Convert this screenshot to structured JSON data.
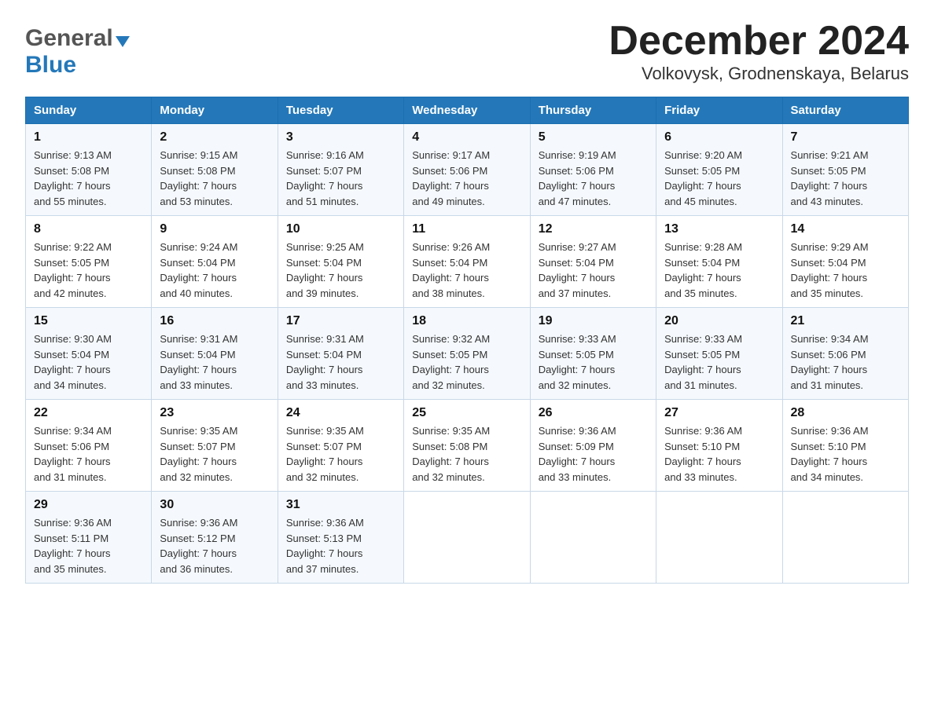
{
  "logo": {
    "line1": "General",
    "line2": "Blue"
  },
  "title": "December 2024",
  "subtitle": "Volkovysk, Grodnenskaya, Belarus",
  "days_of_week": [
    "Sunday",
    "Monday",
    "Tuesday",
    "Wednesday",
    "Thursday",
    "Friday",
    "Saturday"
  ],
  "weeks": [
    [
      {
        "day": "1",
        "sunrise": "9:13 AM",
        "sunset": "5:08 PM",
        "daylight": "7 hours and 55 minutes."
      },
      {
        "day": "2",
        "sunrise": "9:15 AM",
        "sunset": "5:08 PM",
        "daylight": "7 hours and 53 minutes."
      },
      {
        "day": "3",
        "sunrise": "9:16 AM",
        "sunset": "5:07 PM",
        "daylight": "7 hours and 51 minutes."
      },
      {
        "day": "4",
        "sunrise": "9:17 AM",
        "sunset": "5:06 PM",
        "daylight": "7 hours and 49 minutes."
      },
      {
        "day": "5",
        "sunrise": "9:19 AM",
        "sunset": "5:06 PM",
        "daylight": "7 hours and 47 minutes."
      },
      {
        "day": "6",
        "sunrise": "9:20 AM",
        "sunset": "5:05 PM",
        "daylight": "7 hours and 45 minutes."
      },
      {
        "day": "7",
        "sunrise": "9:21 AM",
        "sunset": "5:05 PM",
        "daylight": "7 hours and 43 minutes."
      }
    ],
    [
      {
        "day": "8",
        "sunrise": "9:22 AM",
        "sunset": "5:05 PM",
        "daylight": "7 hours and 42 minutes."
      },
      {
        "day": "9",
        "sunrise": "9:24 AM",
        "sunset": "5:04 PM",
        "daylight": "7 hours and 40 minutes."
      },
      {
        "day": "10",
        "sunrise": "9:25 AM",
        "sunset": "5:04 PM",
        "daylight": "7 hours and 39 minutes."
      },
      {
        "day": "11",
        "sunrise": "9:26 AM",
        "sunset": "5:04 PM",
        "daylight": "7 hours and 38 minutes."
      },
      {
        "day": "12",
        "sunrise": "9:27 AM",
        "sunset": "5:04 PM",
        "daylight": "7 hours and 37 minutes."
      },
      {
        "day": "13",
        "sunrise": "9:28 AM",
        "sunset": "5:04 PM",
        "daylight": "7 hours and 35 minutes."
      },
      {
        "day": "14",
        "sunrise": "9:29 AM",
        "sunset": "5:04 PM",
        "daylight": "7 hours and 35 minutes."
      }
    ],
    [
      {
        "day": "15",
        "sunrise": "9:30 AM",
        "sunset": "5:04 PM",
        "daylight": "7 hours and 34 minutes."
      },
      {
        "day": "16",
        "sunrise": "9:31 AM",
        "sunset": "5:04 PM",
        "daylight": "7 hours and 33 minutes."
      },
      {
        "day": "17",
        "sunrise": "9:31 AM",
        "sunset": "5:04 PM",
        "daylight": "7 hours and 33 minutes."
      },
      {
        "day": "18",
        "sunrise": "9:32 AM",
        "sunset": "5:05 PM",
        "daylight": "7 hours and 32 minutes."
      },
      {
        "day": "19",
        "sunrise": "9:33 AM",
        "sunset": "5:05 PM",
        "daylight": "7 hours and 32 minutes."
      },
      {
        "day": "20",
        "sunrise": "9:33 AM",
        "sunset": "5:05 PM",
        "daylight": "7 hours and 31 minutes."
      },
      {
        "day": "21",
        "sunrise": "9:34 AM",
        "sunset": "5:06 PM",
        "daylight": "7 hours and 31 minutes."
      }
    ],
    [
      {
        "day": "22",
        "sunrise": "9:34 AM",
        "sunset": "5:06 PM",
        "daylight": "7 hours and 31 minutes."
      },
      {
        "day": "23",
        "sunrise": "9:35 AM",
        "sunset": "5:07 PM",
        "daylight": "7 hours and 32 minutes."
      },
      {
        "day": "24",
        "sunrise": "9:35 AM",
        "sunset": "5:07 PM",
        "daylight": "7 hours and 32 minutes."
      },
      {
        "day": "25",
        "sunrise": "9:35 AM",
        "sunset": "5:08 PM",
        "daylight": "7 hours and 32 minutes."
      },
      {
        "day": "26",
        "sunrise": "9:36 AM",
        "sunset": "5:09 PM",
        "daylight": "7 hours and 33 minutes."
      },
      {
        "day": "27",
        "sunrise": "9:36 AM",
        "sunset": "5:10 PM",
        "daylight": "7 hours and 33 minutes."
      },
      {
        "day": "28",
        "sunrise": "9:36 AM",
        "sunset": "5:10 PM",
        "daylight": "7 hours and 34 minutes."
      }
    ],
    [
      {
        "day": "29",
        "sunrise": "9:36 AM",
        "sunset": "5:11 PM",
        "daylight": "7 hours and 35 minutes."
      },
      {
        "day": "30",
        "sunrise": "9:36 AM",
        "sunset": "5:12 PM",
        "daylight": "7 hours and 36 minutes."
      },
      {
        "day": "31",
        "sunrise": "9:36 AM",
        "sunset": "5:13 PM",
        "daylight": "7 hours and 37 minutes."
      },
      null,
      null,
      null,
      null
    ]
  ],
  "sunrise_label": "Sunrise:",
  "sunset_label": "Sunset:",
  "daylight_label": "Daylight:"
}
